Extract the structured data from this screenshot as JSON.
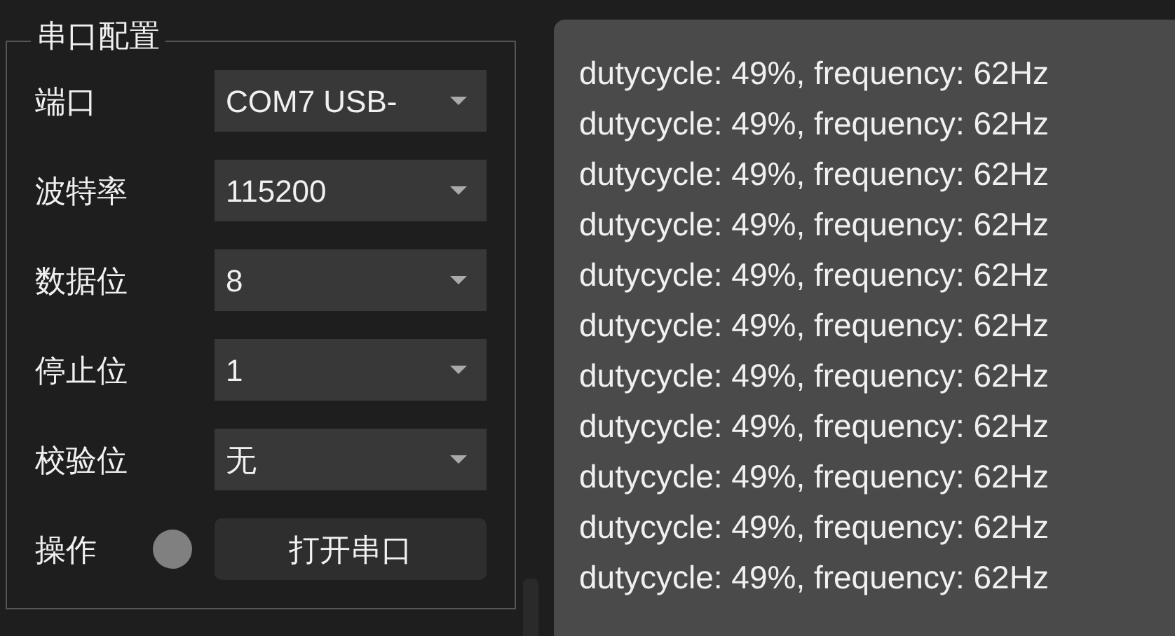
{
  "serial_config": {
    "title": "串口配置",
    "fields": [
      {
        "label": "端口",
        "value": "COM7 USB-"
      },
      {
        "label": "波特率",
        "value": "115200"
      },
      {
        "label": "数据位",
        "value": "8"
      },
      {
        "label": "停止位",
        "value": "1"
      },
      {
        "label": "校验位",
        "value": "无"
      }
    ],
    "operation": {
      "label": "操作",
      "indicator": {
        "on": false
      },
      "button": "打开串口"
    }
  },
  "log": {
    "lines": [
      "dutycycle: 49%, frequency: 62Hz",
      "dutycycle: 49%, frequency: 62Hz",
      "dutycycle: 49%, frequency: 62Hz",
      "dutycycle: 49%, frequency: 62Hz",
      "dutycycle: 49%, frequency: 62Hz",
      "dutycycle: 49%, frequency: 62Hz",
      "dutycycle: 49%, frequency: 62Hz",
      "dutycycle: 49%, frequency: 62Hz",
      "dutycycle: 49%, frequency: 62Hz",
      "dutycycle: 49%, frequency: 62Hz",
      "dutycycle: 49%, frequency: 62Hz"
    ]
  }
}
